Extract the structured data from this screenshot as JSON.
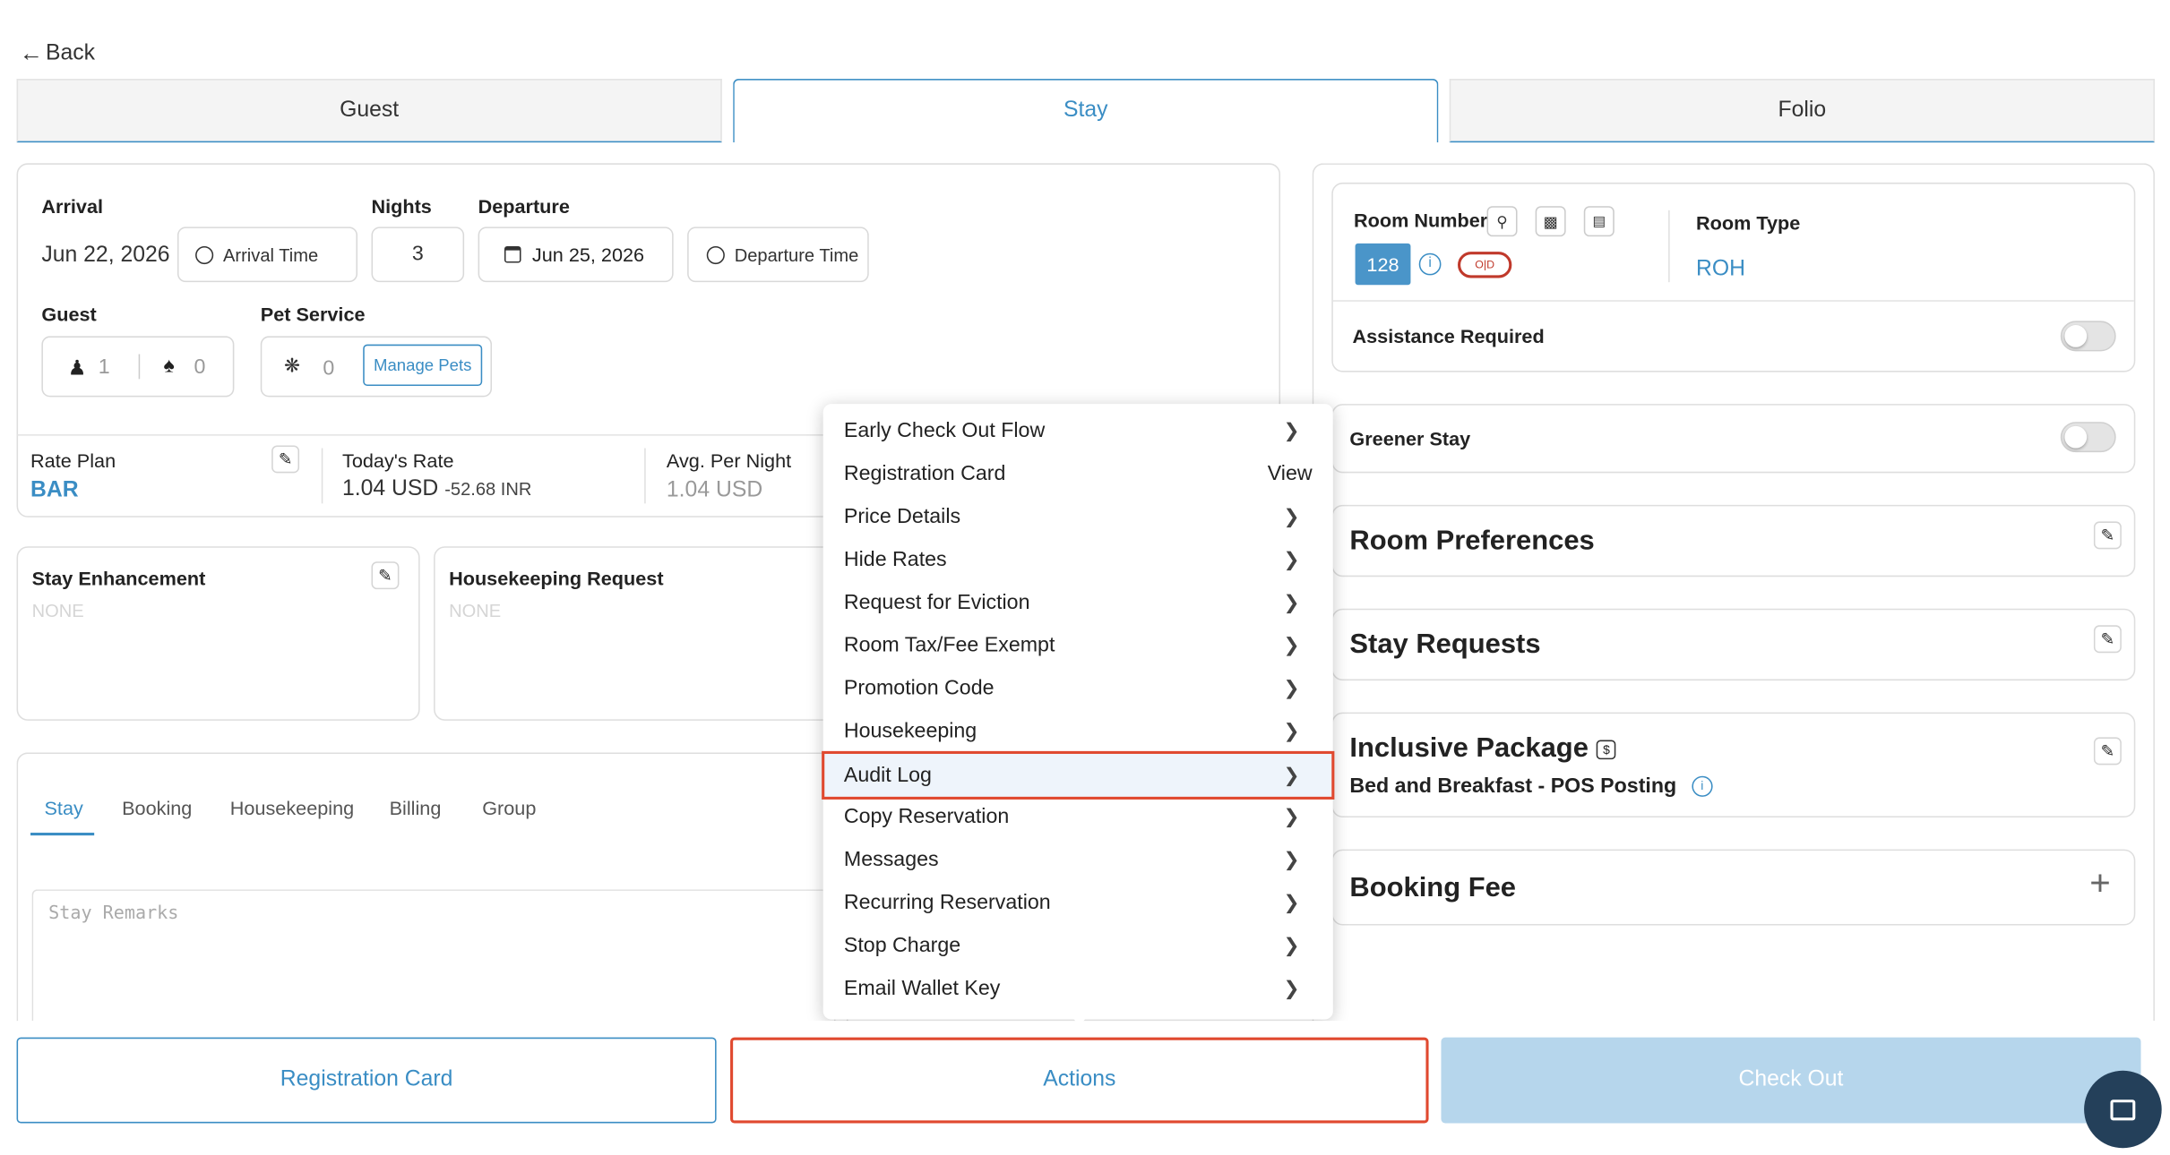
{
  "nav": {
    "back_label": "Back"
  },
  "tabs": [
    {
      "label": "Guest"
    },
    {
      "label": "Stay"
    },
    {
      "label": "Folio"
    }
  ],
  "stay": {
    "arrival_label": "Arrival",
    "arrival_value": "Jun 22, 2026",
    "arrival_time_label": "Arrival Time",
    "nights_label": "Nights",
    "nights_value": "3",
    "departure_label": "Departure",
    "departure_value": "Jun 25, 2026",
    "departure_time_label": "Departure Time",
    "guest_label": "Guest",
    "adults": "1",
    "children": "0",
    "pet_label": "Pet Service",
    "pets": "0",
    "manage_pets_label": "Manage Pets"
  },
  "rates": {
    "rate_plan_label": "Rate Plan",
    "rate_plan_value": "BAR",
    "todays_rate_label": "Today's Rate",
    "todays_rate_value": "1.04 USD",
    "todays_rate_alt": "-52.68 INR",
    "avg_label": "Avg. Per Night",
    "avg_value": "1.04 USD"
  },
  "enhancement": {
    "title": "Stay Enhancement",
    "value": "NONE"
  },
  "housekeeping_req": {
    "title": "Housekeeping Request",
    "value": "NONE"
  },
  "subtabs": [
    {
      "label": "Stay"
    },
    {
      "label": "Booking"
    },
    {
      "label": "Housekeeping"
    },
    {
      "label": "Billing"
    },
    {
      "label": "Group"
    }
  ],
  "remarks_placeholder": "Stay Remarks",
  "room": {
    "room_number_label": "Room Number",
    "room_number": "128",
    "status_badge": "O|D",
    "room_type_label": "Room Type",
    "room_type_value": "ROH",
    "assistance_label": "Assistance Required"
  },
  "panels": {
    "greener_stay": "Greener Stay",
    "room_preferences": "Room Preferences",
    "stay_requests": "Stay Requests",
    "inclusive_package": "Inclusive Package",
    "inclusive_package_value": "Bed and Breakfast - POS Posting",
    "booking_fee": "Booking Fee"
  },
  "menu": {
    "items": [
      {
        "label": "Early Check Out Flow"
      },
      {
        "label": "Registration Card",
        "action": "View"
      },
      {
        "label": "Price Details"
      },
      {
        "label": "Hide Rates"
      },
      {
        "label": "Request for Eviction"
      },
      {
        "label": "Room Tax/Fee Exempt"
      },
      {
        "label": "Promotion Code"
      },
      {
        "label": "Housekeeping"
      },
      {
        "label": "Audit Log",
        "highlighted": true
      },
      {
        "label": "Copy Reservation"
      },
      {
        "label": "Messages"
      },
      {
        "label": "Recurring Reservation"
      },
      {
        "label": "Stop Charge"
      },
      {
        "label": "Email Wallet Key"
      }
    ]
  },
  "footer": {
    "registration_card_label": "Registration Card",
    "actions_label": "Actions",
    "check_out_label": "Check Out"
  },
  "colors": {
    "accent": "#3a8dc4",
    "highlight_border": "#e0492f",
    "checkout_disabled": "#b6d6ec",
    "chat_button": "#24405a"
  }
}
